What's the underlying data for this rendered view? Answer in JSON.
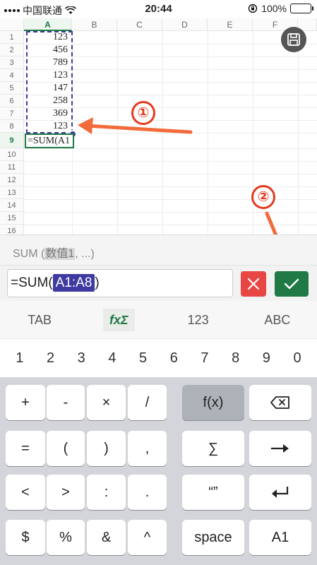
{
  "status_bar": {
    "carrier": "中国联通",
    "time": "20:44",
    "battery": "100%"
  },
  "sheet": {
    "columns": [
      "A",
      "B",
      "C",
      "D",
      "E",
      "F"
    ],
    "rows": [
      "1",
      "2",
      "3",
      "4",
      "5",
      "6",
      "7",
      "8",
      "9",
      "10",
      "11",
      "12",
      "13",
      "14",
      "15",
      "16"
    ],
    "cells_a": [
      "123",
      "456",
      "789",
      "123",
      "147",
      "258",
      "369",
      "123"
    ],
    "active_cell_text": "=SUM(A1",
    "active_column": "A",
    "active_row": "9"
  },
  "annotations": {
    "step1": "①",
    "step2": "②",
    "color": "#e53a1f"
  },
  "hint": {
    "func": "SUM (",
    "arg": "数值1",
    "rest": ", ...)"
  },
  "formula": {
    "prefix": "=SUM(",
    "ref": "A1:A8",
    "suffix": ")"
  },
  "keyboard_tabs": [
    "TAB",
    "fxΣ",
    "123",
    "ABC"
  ],
  "number_row": [
    "1",
    "2",
    "3",
    "4",
    "5",
    "6",
    "7",
    "8",
    "9",
    "0"
  ],
  "keys": {
    "plus": "+",
    "minus": "-",
    "times": "×",
    "divide": "/",
    "fx": "f(x)",
    "equals": "=",
    "lparen": "(",
    "rparen": ")",
    "comma": ",",
    "sum": "∑",
    "lt": "<",
    "gt": ">",
    "colon": ":",
    "dot": ".",
    "quotes": "“”",
    "dollar": "$",
    "percent": "%",
    "amp": "&",
    "caret": "^",
    "space": "space",
    "a1": "A1"
  },
  "colors": {
    "accent": "#1f7a45",
    "range": "#3c3c9a",
    "cancel": "#e84545"
  }
}
